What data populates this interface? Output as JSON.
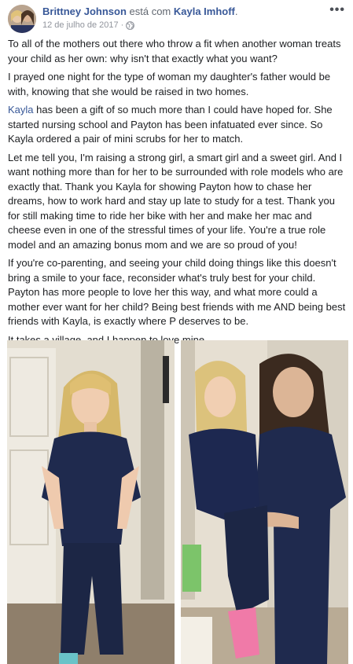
{
  "post": {
    "author": "Brittney Johnson",
    "verb": " está com ",
    "tagged": "Kayla Imhoff",
    "tagged_suffix": ".",
    "date": "12 de julho de 2017",
    "date_sep": " · ",
    "privacy_icon": "globe-icon",
    "options_icon": "more-options-icon",
    "options_label": "•••"
  },
  "body": {
    "p1": "To all of the mothers out there who throw a fit when another woman treats your child as her own: why isn't that exactly what you want?",
    "p2": "I prayed one night for the type of woman my daughter's father would be with, knowing that she would be raised in two homes.",
    "p3_mention": "Kayla",
    "p3_rest": " has been a gift of so much more than I could have hoped for. She started nursing school and Payton has been infatuated ever since. So Kayla ordered a pair of mini scrubs for her to match.",
    "p4": "Let me tell you, I'm raising a strong girl, a smart girl and a sweet girl. And I want nothing more than for her to be surrounded with role models who are exactly that. Thank you Kayla for showing Payton how to chase her dreams, how to work hard and stay up late to study for a test. Thank you for still making time to ride her bike with her and make her mac and cheese even in one of the stressful times of your life. You're a true role model and an amazing bonus mom and we are so proud of you!",
    "p5": "If you're co-parenting, and seeing your child doing things like this doesn't bring a smile to your face, reconsider what's truly best for your child. Payton has more people to love her this way, and what more could a mother ever want for her child? Being best friends with me AND being best friends with Kayla, is exactly where P deserves to be.",
    "p6": "It takes a village, and I happen to love mine."
  },
  "colors": {
    "link": "#385898",
    "meta": "#90949c",
    "text": "#1c1e21",
    "scrubs": "#1f2a4e"
  }
}
